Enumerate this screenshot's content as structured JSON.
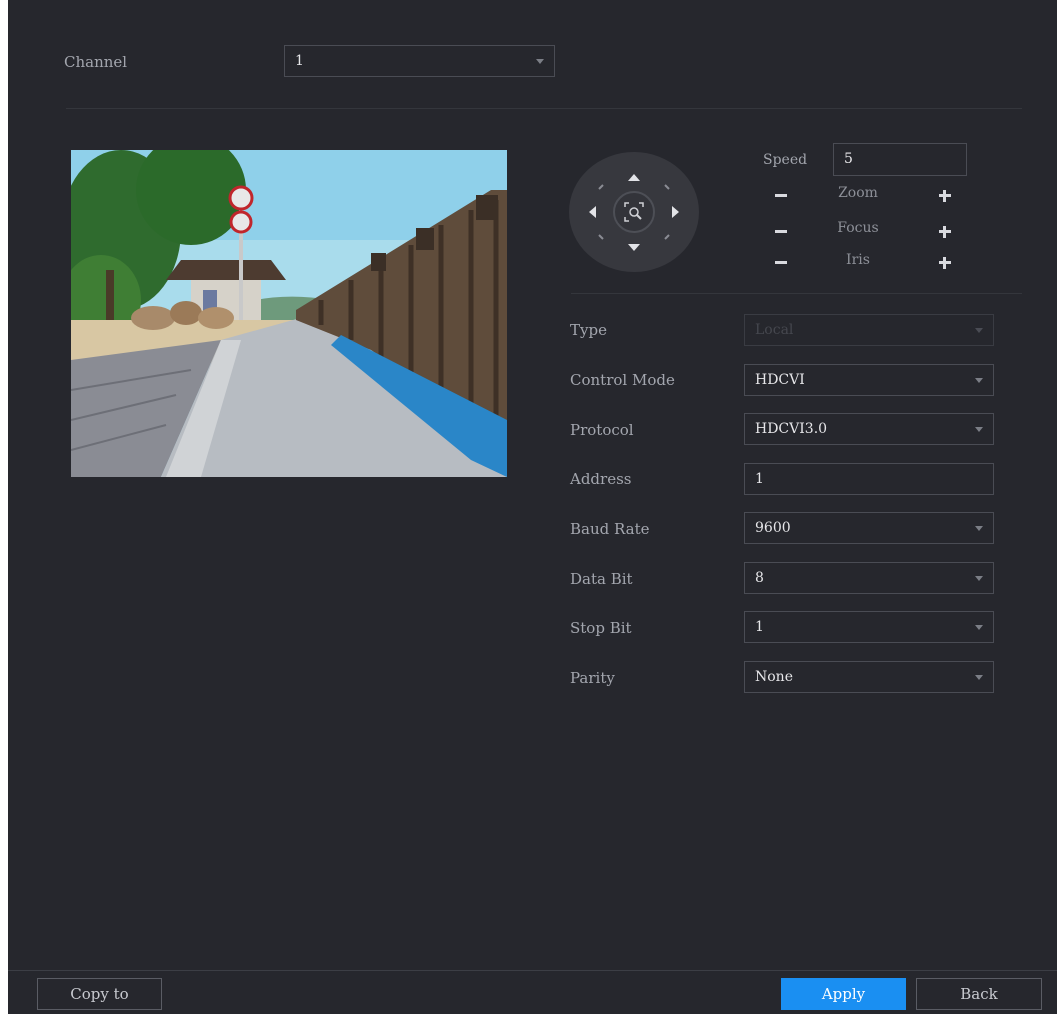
{
  "channel": {
    "label": "Channel",
    "value": "1"
  },
  "ptz": {
    "speed_label": "Speed",
    "speed_value": "5",
    "zoom_label": "Zoom",
    "focus_label": "Focus",
    "iris_label": "Iris"
  },
  "settings": {
    "type": {
      "label": "Type",
      "value": "Local"
    },
    "control_mode": {
      "label": "Control Mode",
      "value": "HDCVI"
    },
    "protocol": {
      "label": "Protocol",
      "value": "HDCVI3.0"
    },
    "address": {
      "label": "Address",
      "value": "1"
    },
    "baud_rate": {
      "label": "Baud Rate",
      "value": "9600"
    },
    "data_bit": {
      "label": "Data Bit",
      "value": "8"
    },
    "stop_bit": {
      "label": "Stop Bit",
      "value": "1"
    },
    "parity": {
      "label": "Parity",
      "value": "None"
    }
  },
  "footer": {
    "copy_label": "Copy to",
    "apply_label": "Apply",
    "back_label": "Back"
  },
  "colors": {
    "panel_bg": "#26272d",
    "accent": "#1a8ff2"
  }
}
